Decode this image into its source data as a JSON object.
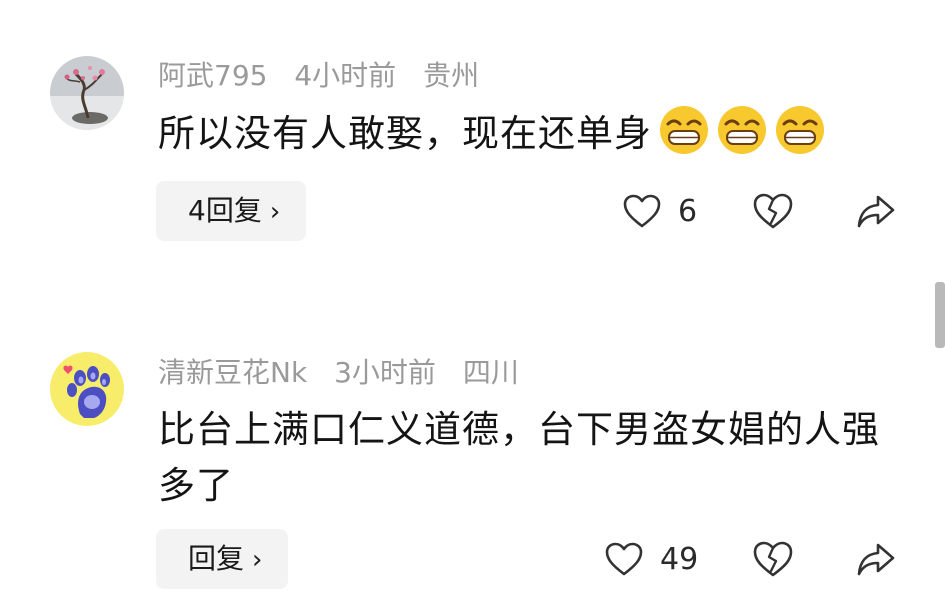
{
  "comments": [
    {
      "username": "阿武795",
      "time": "4小时前",
      "location": "贵州",
      "text": "所以没有人敢娶，现在还单身",
      "emojis": [
        "grin-emoji",
        "grin-emoji",
        "grin-emoji"
      ],
      "reply_label": "4回复",
      "likes": "6"
    },
    {
      "username": "清新豆花Nk",
      "time": "3小时前",
      "location": "四川",
      "text": "比台上满口仁义道德，台下男盗女娼的人强多了",
      "reply_label": "回复",
      "likes": "49"
    }
  ],
  "icons": {
    "like": "heart-outline-icon",
    "dislike": "broken-heart-icon",
    "share": "share-arrow-icon",
    "reply_chevron": "chevron-right-icon"
  },
  "symbols": {
    "chevron": "›"
  },
  "colors": {
    "meta_text": "#9a9a9a",
    "body_text": "#141414",
    "reply_bg": "#f3f3f3",
    "icon_stroke": "#333333",
    "avatar2_bg": "#f7ed6a",
    "paw_color": "#4b4fc2"
  }
}
